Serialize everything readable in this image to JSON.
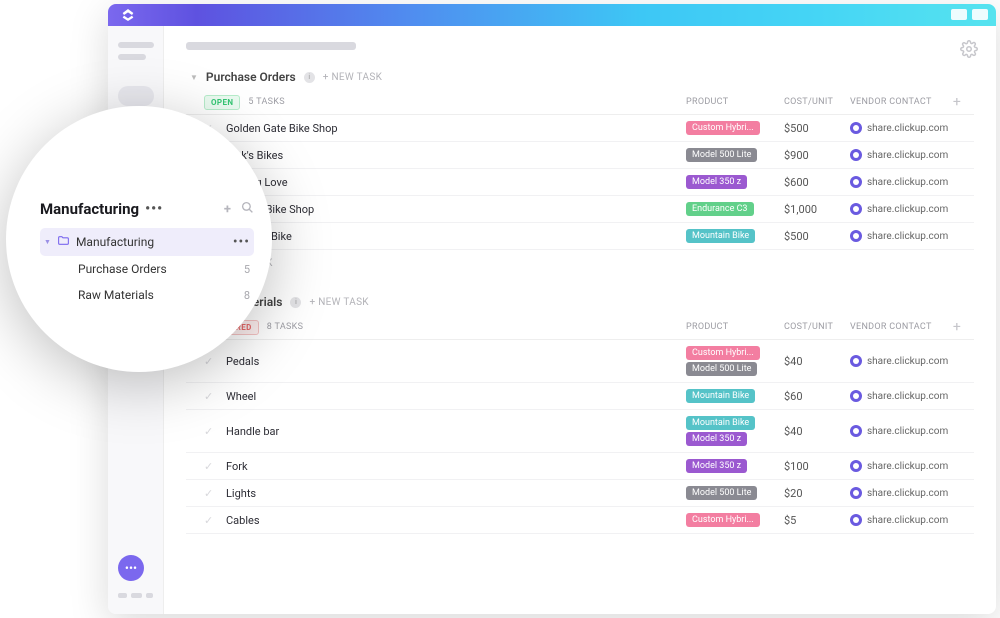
{
  "circle": {
    "title": "Manufacturing",
    "folder": {
      "name": "Manufacturing"
    },
    "lists": [
      {
        "name": "Purchase Orders",
        "count": 5
      },
      {
        "name": "Raw Materials",
        "count": 8
      }
    ]
  },
  "groups": [
    {
      "title": "Purchase Orders",
      "status": {
        "label": "OPEN",
        "class": "st-open"
      },
      "task_count": "5 TASKS",
      "new_task": "+ NEW TASK",
      "add_task": "+ ADD TASK",
      "columns": {
        "product": "PRODUCT",
        "cost": "COST/UNIT",
        "vendor": "VENDOR CONTACT"
      },
      "rows": [
        {
          "name": "Golden Gate Bike Shop",
          "tags": [
            {
              "label": "Custom Hybri...",
              "color": "#f37ea1"
            }
          ],
          "cost": "$500",
          "vendor": "share.clickup.com"
        },
        {
          "name": "Rick's Bikes",
          "tags": [
            {
              "label": "Model 500 Lite",
              "color": "#8a8a92"
            }
          ],
          "cost": "$900",
          "vendor": "share.clickup.com"
        },
        {
          "name": "Cycling Love",
          "tags": [
            {
              "label": "Model 350 z",
              "color": "#9b59d0"
            }
          ],
          "cost": "$600",
          "vendor": "share.clickup.com"
        },
        {
          "name": "Jenna's Bike Shop",
          "tags": [
            {
              "label": "Endurance C3",
              "color": "#62d08a"
            }
          ],
          "cost": "$1,000",
          "vendor": "share.clickup.com"
        },
        {
          "name": "Rainbow Bike",
          "tags": [
            {
              "label": "Mountain Bike",
              "color": "#55c3c8"
            }
          ],
          "cost": "$500",
          "vendor": "share.clickup.com"
        }
      ]
    },
    {
      "title": "Raw Materials",
      "status": {
        "label": "REQUIRED",
        "class": "st-req"
      },
      "task_count": "8 TASKS",
      "new_task": "+ NEW TASK",
      "columns": {
        "product": "PRODUCT",
        "cost": "COST/UNIT",
        "vendor": "VENDOR CONTACT"
      },
      "rows": [
        {
          "name": "Pedals",
          "tags": [
            {
              "label": "Custom Hybri...",
              "color": "#f37ea1"
            },
            {
              "label": "Model 500 Lite",
              "color": "#8a8a92"
            }
          ],
          "cost": "$40",
          "vendor": "share.clickup.com"
        },
        {
          "name": "Wheel",
          "tags": [
            {
              "label": "Mountain Bike",
              "color": "#55c3c8"
            }
          ],
          "cost": "$60",
          "vendor": "share.clickup.com"
        },
        {
          "name": "Handle bar",
          "tags": [
            {
              "label": "Mountain Bike",
              "color": "#55c3c8"
            },
            {
              "label": "Model 350 z",
              "color": "#9b59d0"
            }
          ],
          "cost": "$40",
          "vendor": "share.clickup.com"
        },
        {
          "name": "Fork",
          "tags": [
            {
              "label": "Model 350 z",
              "color": "#9b59d0"
            }
          ],
          "cost": "$100",
          "vendor": "share.clickup.com"
        },
        {
          "name": "Lights",
          "tags": [
            {
              "label": "Model 500 Lite",
              "color": "#8a8a92"
            }
          ],
          "cost": "$20",
          "vendor": "share.clickup.com"
        },
        {
          "name": "Cables",
          "tags": [
            {
              "label": "Custom Hybri...",
              "color": "#f37ea1"
            }
          ],
          "cost": "$5",
          "vendor": "share.clickup.com"
        }
      ]
    }
  ]
}
